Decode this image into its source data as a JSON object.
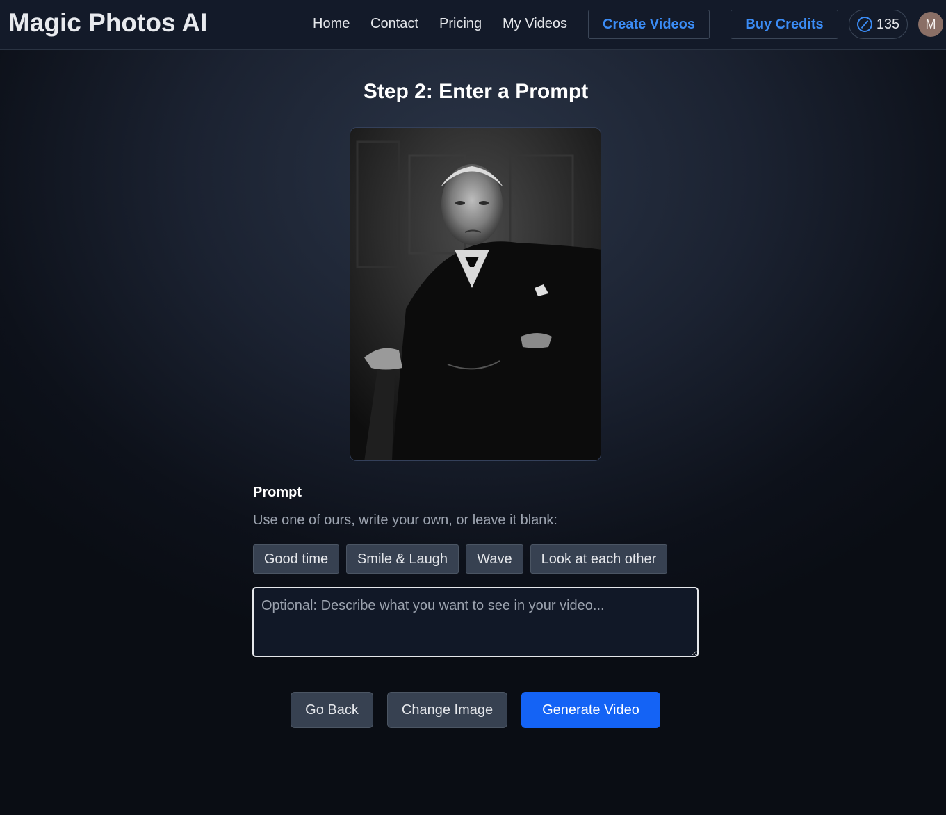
{
  "app": {
    "brand": "Magic Photos AI"
  },
  "nav": {
    "links": [
      "Home",
      "Contact",
      "Pricing",
      "My Videos"
    ],
    "create_videos": "Create Videos",
    "buy_credits": "Buy Credits",
    "credits": "135",
    "avatar_initial": "M"
  },
  "main": {
    "step_title": "Step 2: Enter a Prompt",
    "prompt_label": "Prompt",
    "prompt_help": "Use one of ours, write your own, or leave it blank:",
    "chips": [
      "Good time",
      "Smile & Laugh",
      "Wave",
      "Look at each other"
    ],
    "prompt_placeholder": "Optional: Describe what you want to see in your video...",
    "prompt_value": "",
    "go_back": "Go Back",
    "change_image": "Change Image",
    "generate_video": "Generate Video"
  },
  "colors": {
    "accent": "#3b8cf5",
    "primary_button": "#1463f5",
    "secondary_button": "#374151",
    "navbar": "#131a29"
  },
  "icons": {
    "credits": "credit-coin-icon"
  }
}
